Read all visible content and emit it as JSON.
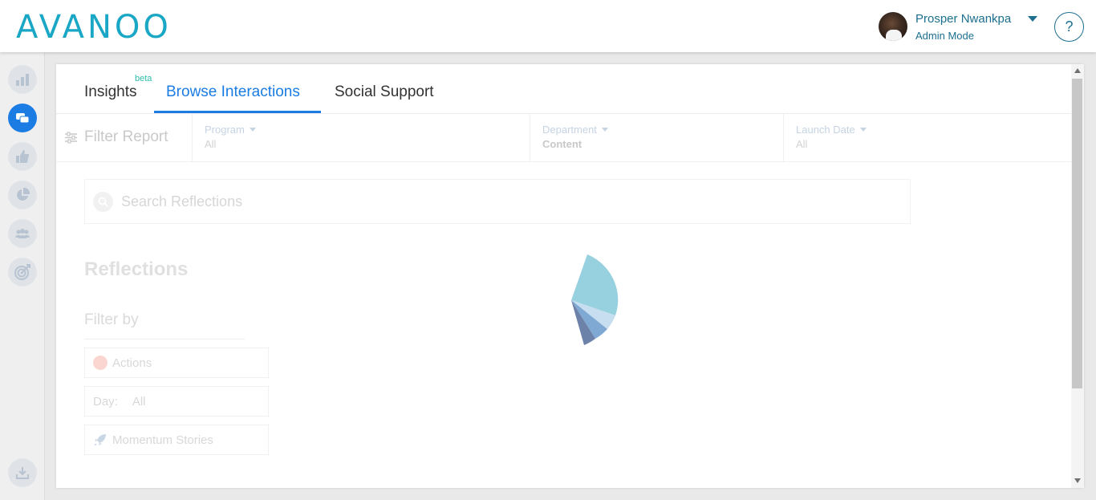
{
  "header": {
    "logo_text": "AVANOO",
    "user_name": "Prosper Nwankpa",
    "user_mode": "Admin Mode",
    "help_label": "?"
  },
  "sidebar": {
    "items": [
      {
        "icon": "bar-chart-icon",
        "active": false
      },
      {
        "icon": "chat-bubbles-icon",
        "active": true
      },
      {
        "icon": "thumbs-up-icon",
        "active": false
      },
      {
        "icon": "pie-chart-icon",
        "active": false
      },
      {
        "icon": "people-icon",
        "active": false
      },
      {
        "icon": "target-icon",
        "active": false
      }
    ],
    "bottom_icon": "download-icon"
  },
  "tabs": {
    "insights": "Insights",
    "insights_badge": "beta",
    "browse": "Browse Interactions",
    "social": "Social Support",
    "active": "Browse Interactions"
  },
  "filters": {
    "title": "Filter Report",
    "program_label": "Program",
    "program_value": "All",
    "department_label": "Department",
    "department_value": "Content",
    "launch_label": "Launch Date",
    "launch_value": "All"
  },
  "search": {
    "placeholder": "Search Reflections"
  },
  "reflections": {
    "title": "Reflections",
    "filter_by": "Filter by",
    "actions_label": "Actions",
    "day_label": "Day:",
    "day_value": "All",
    "momentum_label": "Momentum Stories"
  },
  "colors": {
    "accent": "#1b7ce3",
    "brand": "#1aa7c6",
    "brand_dark": "#1c6f8f",
    "beta": "#2bbfa8"
  }
}
